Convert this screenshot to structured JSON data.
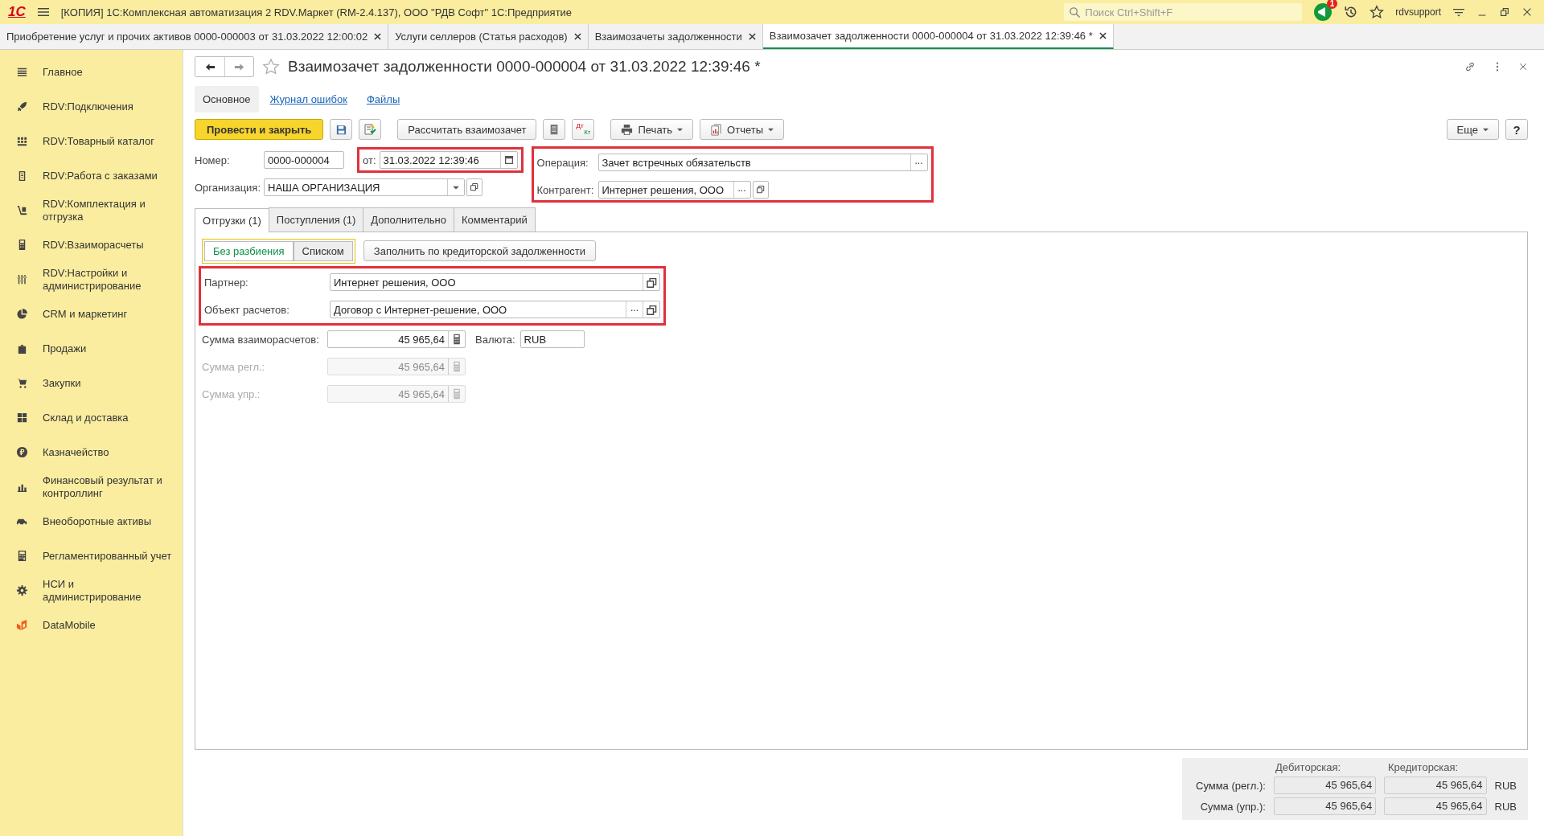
{
  "window": {
    "logo": "1С",
    "title": "[КОПИЯ] 1С:Комплексная автоматизация 2 RDV.Маркет (RM-2.4.137), ООО \"РДВ Софт\" 1С:Предприятие",
    "search": {
      "placeholder": "Поиск Ctrl+Shift+F"
    },
    "notification_count": "1",
    "user": "rdvsupport"
  },
  "open_tabs": [
    {
      "label": "Приобретение услуг и прочих активов 0000-000003 от 31.03.2022 12:00:02",
      "selected": false
    },
    {
      "label": "Услуги селлеров (Статья расходов)",
      "selected": false
    },
    {
      "label": "Взаимозачеты задолженности",
      "selected": false
    },
    {
      "label": "Взаимозачет задолженности 0000-000004 от 31.03.2022 12:39:46 *",
      "selected": true
    }
  ],
  "sidebar": {
    "items": [
      {
        "label": "Главное"
      },
      {
        "label": "RDV:Подключения"
      },
      {
        "label": "RDV:Товарный каталог"
      },
      {
        "label": "RDV:Работа с заказами"
      },
      {
        "label": "RDV:Комплектация и отгрузка"
      },
      {
        "label": "RDV:Взаиморасчеты"
      },
      {
        "label": "RDV:Настройки и администрирование"
      },
      {
        "label": "CRM и маркетинг"
      },
      {
        "label": "Продажи"
      },
      {
        "label": "Закупки"
      },
      {
        "label": "Склад и доставка"
      },
      {
        "label": "Казначейство"
      },
      {
        "label": "Финансовый результат и контроллинг"
      },
      {
        "label": "Внеоборотные активы"
      },
      {
        "label": "Регламентированный учет"
      },
      {
        "label": "НСИ и администрирование"
      },
      {
        "label": "DataMobile"
      }
    ]
  },
  "form": {
    "title": "Взаимозачет задолженности 0000-000004 от 31.03.2022 12:39:46 *",
    "sections": [
      {
        "label": "Основное",
        "selected": true
      },
      {
        "label": "Журнал ошибок",
        "selected": false
      },
      {
        "label": "Файлы",
        "selected": false
      }
    ],
    "toolbar": {
      "post_and_close": "Провести и закрыть",
      "calculate": "Рассчитать взаимозачет",
      "dt": "Дт",
      "kt": "Кт",
      "print": "Печать",
      "reports": "Отчеты",
      "more": "Еще",
      "help": "?"
    },
    "number": {
      "label": "Номер:",
      "value": "0000-000004"
    },
    "date": {
      "label": "от:",
      "value": "31.03.2022 12:39:46"
    },
    "organization": {
      "label": "Организация:",
      "value": "НАША ОРГАНИЗАЦИЯ"
    },
    "operation": {
      "label": "Операция:",
      "value": "Зачет встречных обязательств",
      "choose": "..."
    },
    "counterparty": {
      "label": "Контрагент:",
      "value": "Интернет решения, ООО",
      "choose": "..."
    },
    "tabs": [
      {
        "label": "Отгрузки (1)",
        "selected": true
      },
      {
        "label": "Поступления (1)",
        "selected": false
      },
      {
        "label": "Дополнительно",
        "selected": false
      },
      {
        "label": "Комментарий",
        "selected": false
      }
    ],
    "mode_switch": [
      {
        "label": "Без разбиения",
        "selected": true
      },
      {
        "label": "Списком",
        "selected": false
      }
    ],
    "fill_button": "Заполнить по кредиторской задолженности",
    "partner": {
      "label": "Партнер:",
      "value": "Интернет решения, ООО"
    },
    "settlement_object": {
      "label": "Объект расчетов:",
      "value": "Договор с Интернет-решение, ООО",
      "choose": "..."
    },
    "amounts": [
      {
        "label": "Сумма взаиморасчетов:",
        "value": "45 965,64",
        "disabled": false
      },
      {
        "label": "Сумма регл.:",
        "value": "45 965,64",
        "disabled": true
      },
      {
        "label": "Сумма упр.:",
        "value": "45 965,64",
        "disabled": true
      }
    ],
    "currency": {
      "label": "Валюта:",
      "value": "RUB"
    },
    "totals": {
      "debit_header": "Дебиторская:",
      "credit_header": "Кредиторская:",
      "rows": [
        {
          "label": "Сумма (регл.):",
          "debit": "45 965,64",
          "credit": "45 965,64",
          "currency": "RUB"
        },
        {
          "label": "Сумма (упр.):",
          "debit": "45 965,64",
          "credit": "45 965,64",
          "currency": "RUB"
        }
      ]
    }
  }
}
